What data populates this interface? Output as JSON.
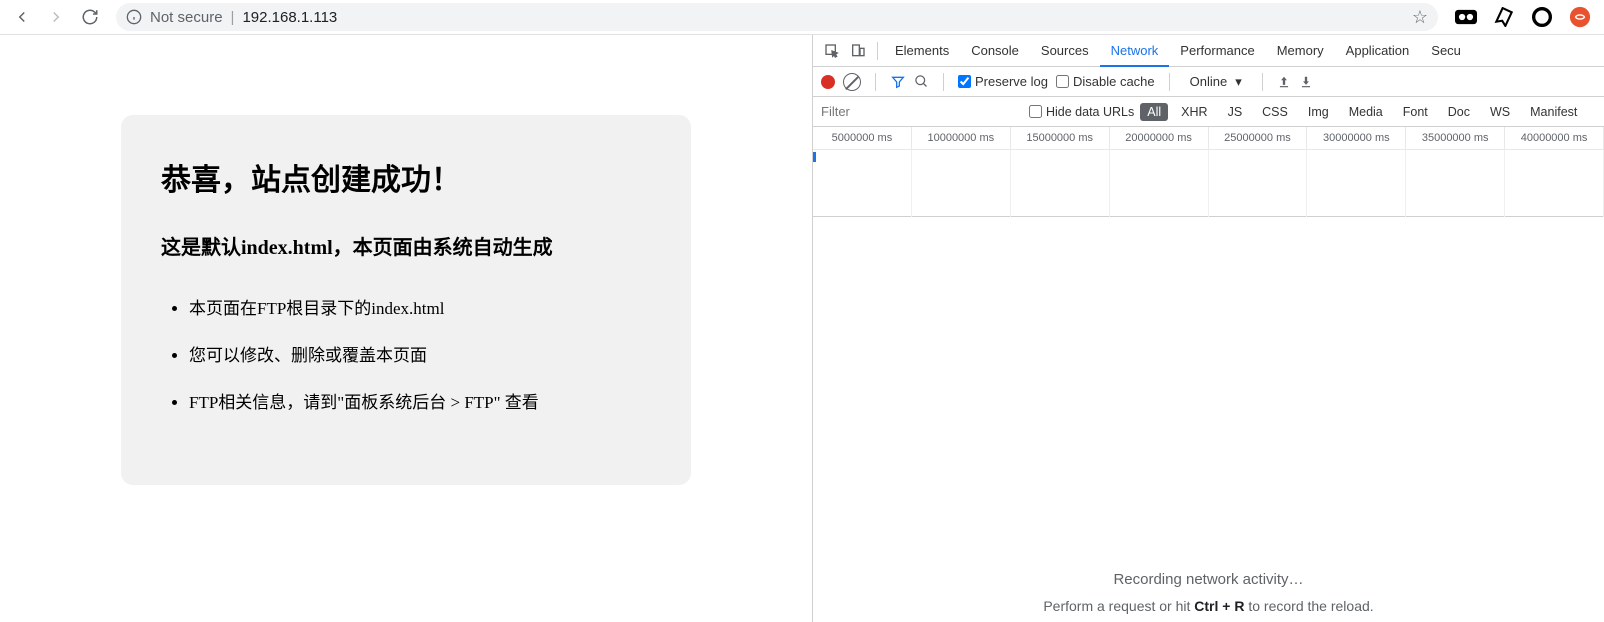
{
  "browser": {
    "not_secure": "Not secure",
    "pipe": "|",
    "url": "192.168.1.113"
  },
  "page": {
    "h1": "恭喜，站点创建成功！",
    "h2": "这是默认index.html，本页面由系统自动生成",
    "items": [
      "本页面在FTP根目录下的index.html",
      "您可以修改、删除或覆盖本页面",
      "FTP相关信息，请到\"面板系统后台 > FTP\" 查看"
    ]
  },
  "devtools": {
    "tabs": [
      "Elements",
      "Console",
      "Sources",
      "Network",
      "Performance",
      "Memory",
      "Application",
      "Secu"
    ],
    "active_tab": "Network",
    "preserve_log": "Preserve log",
    "disable_cache": "Disable cache",
    "throttle": "Online",
    "filter_placeholder": "Filter",
    "hide_data_urls": "Hide data URLs",
    "filter_pills": [
      "All",
      "XHR",
      "JS",
      "CSS",
      "Img",
      "Media",
      "Font",
      "Doc",
      "WS",
      "Manifest"
    ],
    "active_pill": "All",
    "timeline": [
      "5000000 ms",
      "10000000 ms",
      "15000000 ms",
      "20000000 ms",
      "25000000 ms",
      "30000000 ms",
      "35000000 ms",
      "40000000 ms"
    ],
    "recording_title": "Recording network activity…",
    "hint1": "Perform a request or hit ",
    "hint_bold": "Ctrl + R",
    "hint2": " to record the reload."
  }
}
